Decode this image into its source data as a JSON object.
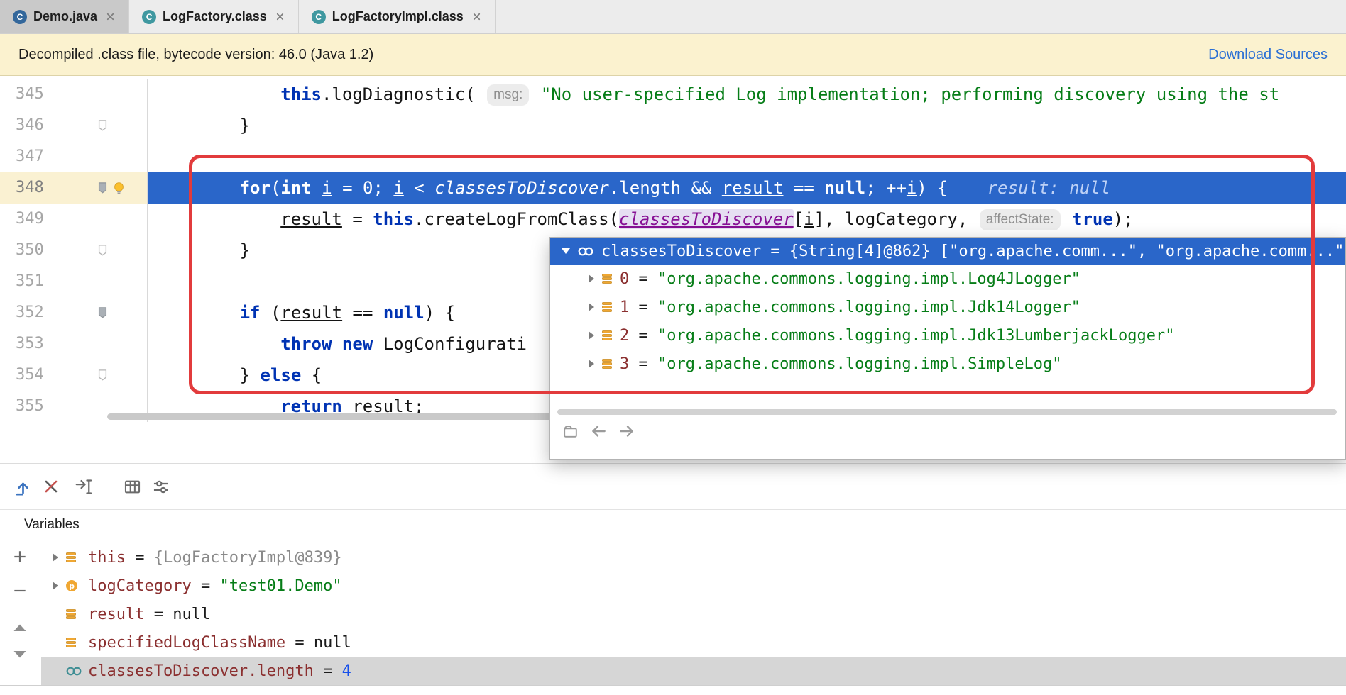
{
  "tabs": [
    {
      "label": "Demo.java",
      "file_type": "java",
      "icon_letter": "C",
      "selected": true
    },
    {
      "label": "LogFactory.class",
      "file_type": "class",
      "icon_letter": "C",
      "selected": false
    },
    {
      "label": "LogFactoryImpl.class",
      "file_type": "class",
      "icon_letter": "C",
      "selected": false
    }
  ],
  "banner": {
    "message": "Decompiled .class file, bytecode version: 46.0 (Java 1.2)",
    "action": "Download Sources"
  },
  "editor": {
    "lines": [
      {
        "num": "345",
        "indent": 8,
        "gutter": [],
        "segments": [
          {
            "t": "this",
            "c": "kw"
          },
          {
            "t": ".logDiagnostic( ",
            "c": "pl"
          },
          {
            "t": "msg:",
            "c": "hint"
          },
          {
            "t": " ",
            "c": "pl"
          },
          {
            "t": "\"No user-specified Log implementation; performing discovery using the st",
            "c": "str"
          }
        ]
      },
      {
        "num": "346",
        "indent": 4,
        "gutter": [
          "bookmark-light"
        ],
        "segments": [
          {
            "t": "}",
            "c": "pl"
          }
        ]
      },
      {
        "num": "347",
        "indent": 0,
        "gutter": [],
        "segments": []
      },
      {
        "num": "348",
        "indent": 4,
        "current": true,
        "gutter": [
          "bookmark-dark",
          "bulb"
        ],
        "segments": [
          {
            "t": "for",
            "c": "kw"
          },
          {
            "t": "(",
            "c": "pl"
          },
          {
            "t": "int",
            "c": "kw"
          },
          {
            "t": " ",
            "c": "pl"
          },
          {
            "t": "i",
            "c": "u"
          },
          {
            "t": " = ",
            "c": "pl"
          },
          {
            "t": "0",
            "c": "num"
          },
          {
            "t": "; ",
            "c": "pl"
          },
          {
            "t": "i",
            "c": "u"
          },
          {
            "t": " < ",
            "c": "pl"
          },
          {
            "t": "classesToDiscover",
            "c": "it"
          },
          {
            "t": ".length && ",
            "c": "pl"
          },
          {
            "t": "result",
            "c": "u"
          },
          {
            "t": " == ",
            "c": "pl"
          },
          {
            "t": "null",
            "c": "kw"
          },
          {
            "t": "; ++",
            "c": "pl"
          },
          {
            "t": "i",
            "c": "u"
          },
          {
            "t": ") {",
            "c": "pl"
          },
          {
            "t": "result: null",
            "c": "dbghint"
          }
        ]
      },
      {
        "num": "349",
        "indent": 8,
        "gutter": [],
        "segments": [
          {
            "t": "result",
            "c": "u"
          },
          {
            "t": " = ",
            "c": "pl"
          },
          {
            "t": "this",
            "c": "kw"
          },
          {
            "t": ".createLogFromClass(",
            "c": "pl"
          },
          {
            "t": "classesToDiscover",
            "c": "hov"
          },
          {
            "t": "[",
            "c": "pl"
          },
          {
            "t": "i",
            "c": "u"
          },
          {
            "t": "], logCategory, ",
            "c": "pl"
          },
          {
            "t": "affectState:",
            "c": "hint"
          },
          {
            "t": " ",
            "c": "pl"
          },
          {
            "t": "true",
            "c": "kw"
          },
          {
            "t": ");",
            "c": "pl"
          }
        ]
      },
      {
        "num": "350",
        "indent": 4,
        "gutter": [
          "bookmark-light"
        ],
        "segments": [
          {
            "t": "}",
            "c": "pl"
          }
        ]
      },
      {
        "num": "351",
        "indent": 0,
        "gutter": [],
        "segments": []
      },
      {
        "num": "352",
        "indent": 4,
        "gutter": [
          "bookmark-dark"
        ],
        "segments": [
          {
            "t": "if",
            "c": "kw"
          },
          {
            "t": " (",
            "c": "pl"
          },
          {
            "t": "result",
            "c": "u"
          },
          {
            "t": " == ",
            "c": "pl"
          },
          {
            "t": "null",
            "c": "kw"
          },
          {
            "t": ") {",
            "c": "pl"
          }
        ]
      },
      {
        "num": "353",
        "indent": 8,
        "gutter": [],
        "segments": [
          {
            "t": "throw",
            "c": "kw"
          },
          {
            "t": " ",
            "c": "pl"
          },
          {
            "t": "new",
            "c": "kw"
          },
          {
            "t": " LogConfigurati",
            "c": "pl"
          }
        ]
      },
      {
        "num": "354",
        "indent": 4,
        "gutter": [
          "bookmark-light"
        ],
        "segments": [
          {
            "t": "} ",
            "c": "pl"
          },
          {
            "t": "else",
            "c": "kw"
          },
          {
            "t": " {",
            "c": "pl"
          }
        ]
      },
      {
        "num": "355",
        "indent": 8,
        "gutter": [],
        "segments": [
          {
            "t": "return",
            "c": "kw"
          },
          {
            "t": " ",
            "c": "pl"
          },
          {
            "t": "result",
            "c": "u"
          },
          {
            "t": ";",
            "c": "pl"
          }
        ]
      }
    ]
  },
  "popup": {
    "equals_sign": " = ",
    "header": {
      "name": "classesToDiscover",
      "eq": " = ",
      "type": "{String[4]@862}",
      "preview": " [\"org.apache.comm...\", \"org.apache.comm...\","
    },
    "rows": [
      {
        "index": "0",
        "value": "\"org.apache.commons.logging.impl.Log4JLogger\""
      },
      {
        "index": "1",
        "value": "\"org.apache.commons.logging.impl.Jdk14Logger\""
      },
      {
        "index": "2",
        "value": "\"org.apache.commons.logging.impl.Jdk13LumberjackLogger\""
      },
      {
        "index": "3",
        "value": "\"org.apache.commons.logging.impl.SimpleLog\""
      }
    ],
    "footer_icons": [
      "options",
      "back",
      "forward"
    ]
  },
  "debug_toolbar": {
    "icons": [
      "step-out",
      "drop-frame",
      "run-to-cursor",
      "table-view",
      "filter"
    ]
  },
  "variables": {
    "title": "Variables",
    "equals_sign": " = ",
    "controls": [
      "add",
      "remove",
      "scroll-up",
      "scroll-down"
    ],
    "rows": [
      {
        "name": "this",
        "value": "{LogFactoryImpl@839}",
        "value_type": "ref",
        "icon": "field",
        "expandable": true,
        "selected": false
      },
      {
        "name": "logCategory",
        "value": "\"test01.Demo\"",
        "value_type": "str",
        "icon": "param",
        "expandable": true,
        "selected": false
      },
      {
        "name": "result",
        "value": "null",
        "value_type": "plain",
        "icon": "field",
        "expandable": false,
        "selected": false
      },
      {
        "name": "specifiedLogClassName",
        "value": "null",
        "value_type": "plain",
        "icon": "field",
        "expandable": false,
        "selected": false
      },
      {
        "name": "classesToDiscover.length",
        "value": "4",
        "value_type": "num",
        "icon": "watch",
        "expandable": false,
        "selected": true
      }
    ]
  },
  "colors": {
    "execution_line_bg": "#2a66c9",
    "selected_row_bg": "#d6d6d6",
    "annotation_red": "#e23b3c",
    "banner_bg": "#fbf2cf",
    "link_blue": "#2a6fd4",
    "string_green": "#067d17",
    "keyword_blue": "#0033b3"
  }
}
